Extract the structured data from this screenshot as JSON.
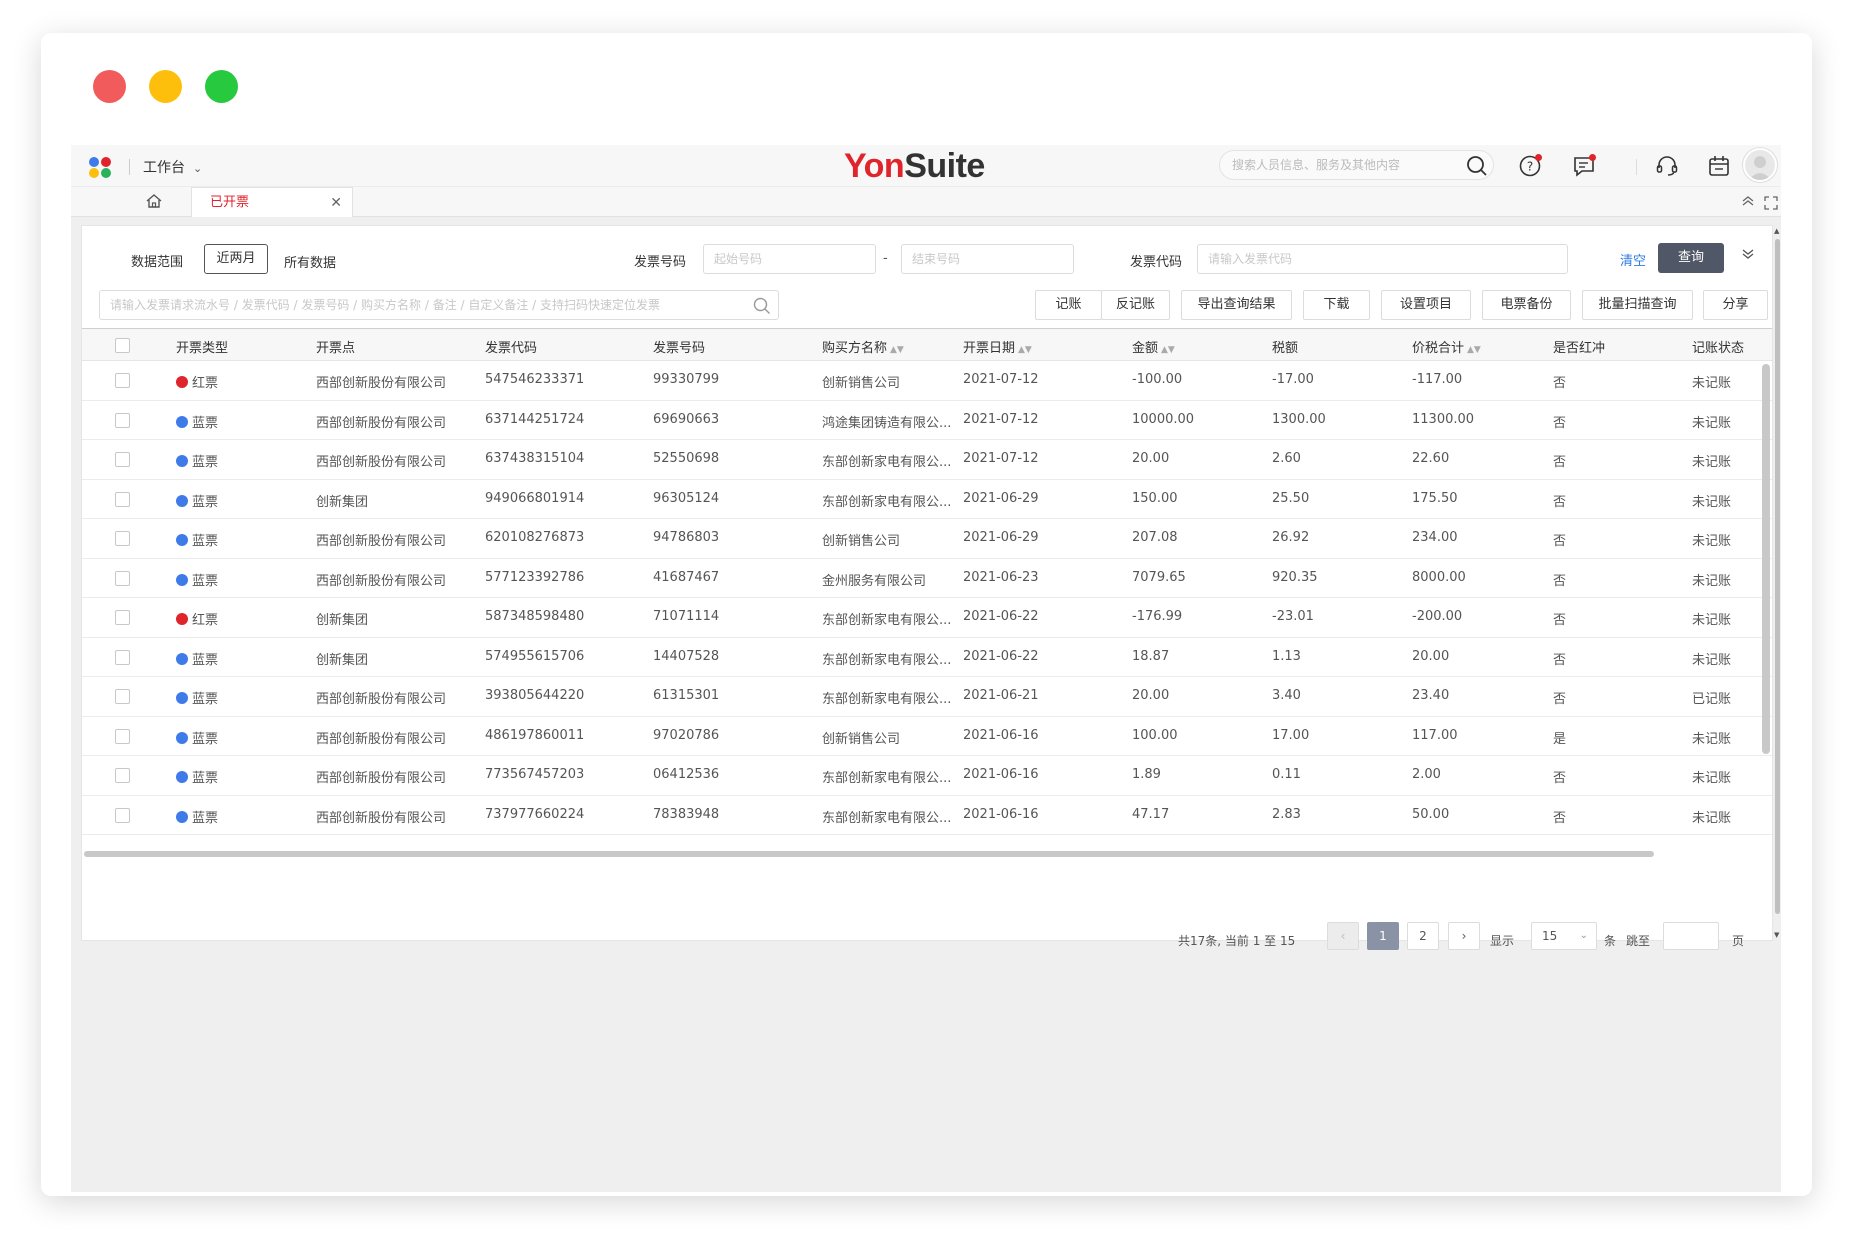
{
  "header": {
    "workspace": "工作台",
    "brand_a": "Yon",
    "brand_b": "Suite",
    "search_placeholder": "搜索人员信息、服务及其他内容"
  },
  "tabs": {
    "active": "已开票"
  },
  "filters": {
    "range_label": "数据范围",
    "range_active": "近两月",
    "range_other": "所有数据",
    "invoice_no_label": "发票号码",
    "invoice_no_start": "起始号码",
    "invoice_no_end": "结束号码",
    "invoice_code_label": "发票代码",
    "invoice_code_placeholder": "请输入发票代码",
    "clear": "清空",
    "query": "查询",
    "keyword_placeholder": "请输入发票请求流水号 / 发票代码 / 发票号码 / 购买方名称 / 备注 / 自定义备注 / 支持扫码快速定位发票"
  },
  "toolbar": [
    "记账",
    "反记账",
    "导出查询结果",
    "下载",
    "设置项目",
    "电票备份",
    "批量扫描查询",
    "分享"
  ],
  "columns": [
    "开票类型",
    "开票点",
    "发票代码",
    "发票号码",
    "购买方名称",
    "开票日期",
    "金额",
    "税额",
    "价税合计",
    "是否红冲",
    "记账状态"
  ],
  "colors": {
    "red_dot": "#e0242b",
    "blue_dot": "#3f7be8"
  },
  "rows": [
    {
      "type": "红票",
      "color": "red",
      "point": "西部创新股份有限公司",
      "code": "547546233371",
      "no": "99330799",
      "buyer": "创新销售公司",
      "date": "2021-07-12",
      "amount": "-100.00",
      "tax": "-17.00",
      "total": "-117.00",
      "red": "否",
      "status": "未记账"
    },
    {
      "type": "蓝票",
      "color": "blue",
      "point": "西部创新股份有限公司",
      "code": "637144251724",
      "no": "69690663",
      "buyer": "鸿途集团铸造有限公...",
      "date": "2021-07-12",
      "amount": "10000.00",
      "tax": "1300.00",
      "total": "11300.00",
      "red": "否",
      "status": "未记账"
    },
    {
      "type": "蓝票",
      "color": "blue",
      "point": "西部创新股份有限公司",
      "code": "637438315104",
      "no": "52550698",
      "buyer": "东部创新家电有限公...",
      "date": "2021-07-12",
      "amount": "20.00",
      "tax": "2.60",
      "total": "22.60",
      "red": "否",
      "status": "未记账"
    },
    {
      "type": "蓝票",
      "color": "blue",
      "point": "创新集团",
      "code": "949066801914",
      "no": "96305124",
      "buyer": "东部创新家电有限公...",
      "date": "2021-06-29",
      "amount": "150.00",
      "tax": "25.50",
      "total": "175.50",
      "red": "否",
      "status": "未记账"
    },
    {
      "type": "蓝票",
      "color": "blue",
      "point": "西部创新股份有限公司",
      "code": "620108276873",
      "no": "94786803",
      "buyer": "创新销售公司",
      "date": "2021-06-29",
      "amount": "207.08",
      "tax": "26.92",
      "total": "234.00",
      "red": "否",
      "status": "未记账"
    },
    {
      "type": "蓝票",
      "color": "blue",
      "point": "西部创新股份有限公司",
      "code": "577123392786",
      "no": "41687467",
      "buyer": "金州服务有限公司",
      "date": "2021-06-23",
      "amount": "7079.65",
      "tax": "920.35",
      "total": "8000.00",
      "red": "否",
      "status": "未记账"
    },
    {
      "type": "红票",
      "color": "red",
      "point": "创新集团",
      "code": "587348598480",
      "no": "71071114",
      "buyer": "东部创新家电有限公...",
      "date": "2021-06-22",
      "amount": "-176.99",
      "tax": "-23.01",
      "total": "-200.00",
      "red": "否",
      "status": "未记账"
    },
    {
      "type": "蓝票",
      "color": "blue",
      "point": "创新集团",
      "code": "574955615706",
      "no": "14407528",
      "buyer": "东部创新家电有限公...",
      "date": "2021-06-22",
      "amount": "18.87",
      "tax": "1.13",
      "total": "20.00",
      "red": "否",
      "status": "未记账"
    },
    {
      "type": "蓝票",
      "color": "blue",
      "point": "西部创新股份有限公司",
      "code": "393805644220",
      "no": "61315301",
      "buyer": "东部创新家电有限公...",
      "date": "2021-06-21",
      "amount": "20.00",
      "tax": "3.40",
      "total": "23.40",
      "red": "否",
      "status": "已记账"
    },
    {
      "type": "蓝票",
      "color": "blue",
      "point": "西部创新股份有限公司",
      "code": "486197860011",
      "no": "97020786",
      "buyer": "创新销售公司",
      "date": "2021-06-16",
      "amount": "100.00",
      "tax": "17.00",
      "total": "117.00",
      "red": "是",
      "status": "未记账"
    },
    {
      "type": "蓝票",
      "color": "blue",
      "point": "西部创新股份有限公司",
      "code": "773567457203",
      "no": "06412536",
      "buyer": "东部创新家电有限公...",
      "date": "2021-06-16",
      "amount": "1.89",
      "tax": "0.11",
      "total": "2.00",
      "red": "否",
      "status": "未记账"
    },
    {
      "type": "蓝票",
      "color": "blue",
      "point": "西部创新股份有限公司",
      "code": "737977660224",
      "no": "78383948",
      "buyer": "东部创新家电有限公...",
      "date": "2021-06-16",
      "amount": "47.17",
      "tax": "2.83",
      "total": "50.00",
      "red": "否",
      "status": "未记账"
    }
  ],
  "pager": {
    "summary": "共17条,  当前 1 至 15",
    "page1": "1",
    "page2": "2",
    "show_label": "显示",
    "page_size": "15",
    "unit": "条",
    "jump_label": "跳至",
    "page_unit": "页"
  }
}
